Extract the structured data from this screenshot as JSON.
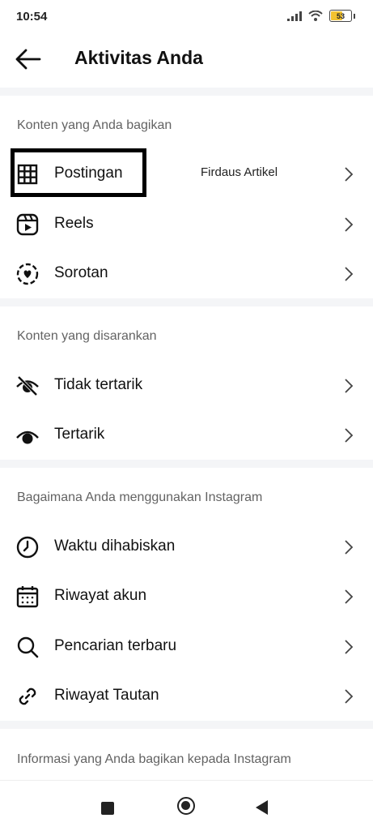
{
  "status_bar": {
    "time": "10:54",
    "battery_level": "53"
  },
  "header": {
    "title": "Aktivitas Anda"
  },
  "sections": [
    {
      "title": "Konten yang Anda bagikan",
      "items": [
        {
          "label": "Postingan",
          "icon": "grid-icon"
        },
        {
          "label": "Reels",
          "icon": "reels-icon"
        },
        {
          "label": "Sorotan",
          "icon": "highlight-heart-icon"
        }
      ]
    },
    {
      "title": "Konten yang disarankan",
      "items": [
        {
          "label": "Tidak tertarik",
          "icon": "eye-off-icon"
        },
        {
          "label": "Tertarik",
          "icon": "eye-icon"
        }
      ]
    },
    {
      "title": "Bagaimana Anda menggunakan Instagram",
      "items": [
        {
          "label": "Waktu dihabiskan",
          "icon": "clock-icon"
        },
        {
          "label": "Riwayat akun",
          "icon": "calendar-icon"
        },
        {
          "label": "Pencarian terbaru",
          "icon": "search-icon"
        },
        {
          "label": "Riwayat Tautan",
          "icon": "link-icon"
        }
      ]
    },
    {
      "title": "Informasi yang Anda bagikan kepada Instagram",
      "items": []
    }
  ],
  "annotation": {
    "text": "Firdaus Artikel"
  }
}
